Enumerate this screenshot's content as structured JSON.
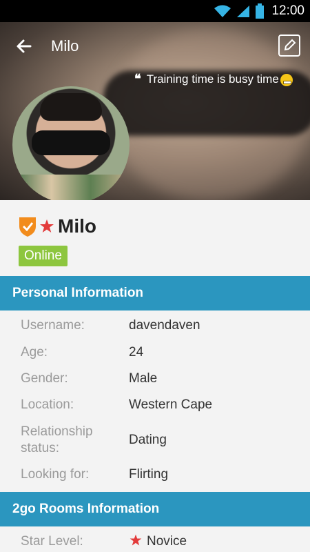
{
  "status_bar": {
    "time": "12:00"
  },
  "header": {
    "title": "Milo"
  },
  "hero": {
    "status_quote": "Training time is busy time"
  },
  "profile": {
    "display_name": "Milo",
    "online_badge": "Online"
  },
  "sections": {
    "personal_info": "Personal Information",
    "rooms_info": "2go Rooms Information"
  },
  "personal_info": [
    {
      "label": "Username:",
      "value": "davendaven"
    },
    {
      "label": "Age:",
      "value": "24"
    },
    {
      "label": "Gender:",
      "value": "Male"
    },
    {
      "label": "Location:",
      "value": "Western Cape"
    },
    {
      "label": "Relationship status:",
      "value": "Dating"
    },
    {
      "label": "Looking for:",
      "value": "Flirting"
    }
  ],
  "rooms_info": [
    {
      "label": "Star Level:",
      "value": "Novice"
    }
  ],
  "colors": {
    "accent": "#2b96bf",
    "online": "#8dc63f",
    "star": "#e33b3b",
    "shield": "#f28c1c"
  }
}
